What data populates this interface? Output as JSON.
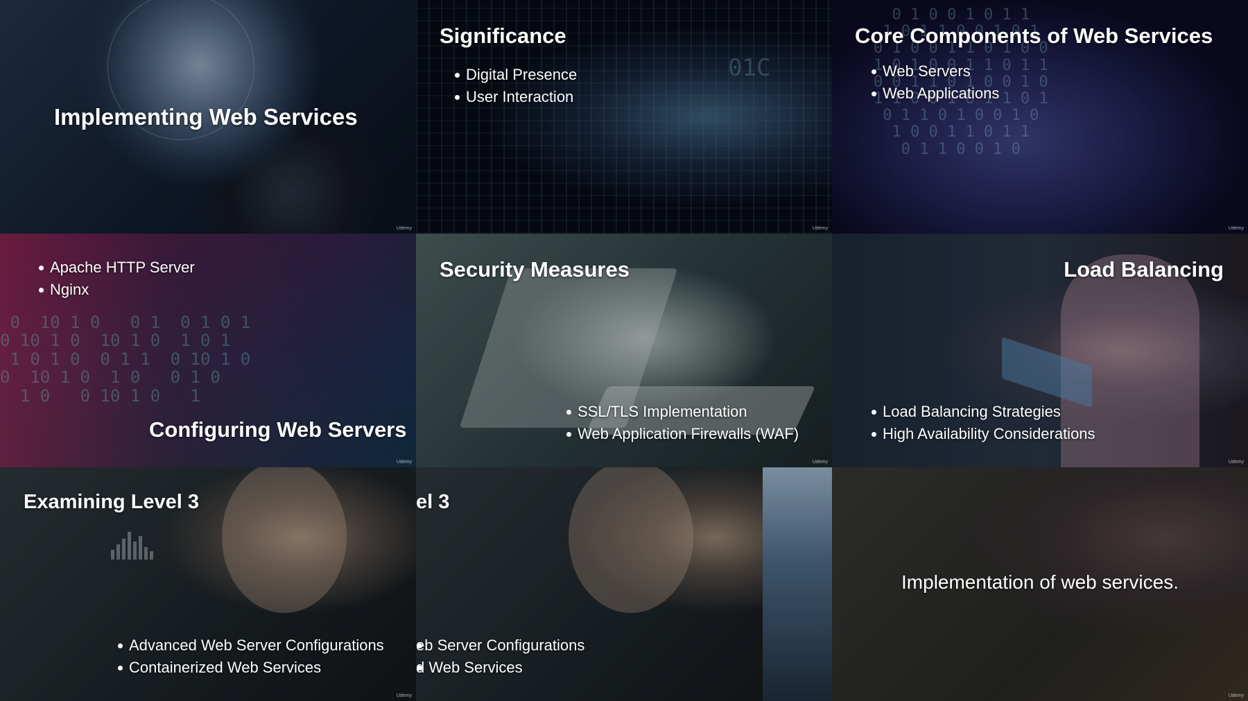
{
  "tiles": [
    {
      "title": "Implementing Web Services",
      "bullets": [],
      "watermark": "Udemy"
    },
    {
      "title": "Significance",
      "bullets": [
        "Digital Presence",
        "User Interaction"
      ],
      "watermark": "Udemy"
    },
    {
      "title": "Core Components of Web Services",
      "bullets": [
        "Web Servers",
        "Web Applications"
      ],
      "watermark": "Udemy"
    },
    {
      "title": "Configuring Web Servers",
      "bullets": [
        "Apache HTTP Server",
        "Nginx"
      ],
      "watermark": "Udemy"
    },
    {
      "title": "Security Measures",
      "bullets": [
        "SSL/TLS Implementation",
        "Web Application Firewalls (WAF)"
      ],
      "watermark": "Udemy"
    },
    {
      "title": "Load Balancing",
      "bullets": [
        "Load Balancing Strategies",
        "High Availability Considerations"
      ],
      "watermark": "Udemy"
    },
    {
      "title": "Examining Level 3",
      "bullets": [
        "Advanced Web Server Configurations",
        "Containerized Web Services"
      ],
      "watermark": "Udemy"
    },
    {
      "title": "el 3",
      "bullets": [
        "eb Server Configurations",
        "d Web Services"
      ],
      "watermark": ""
    },
    {
      "title": "Implementation of web services.",
      "bullets": [],
      "watermark": "Udemy"
    }
  ]
}
